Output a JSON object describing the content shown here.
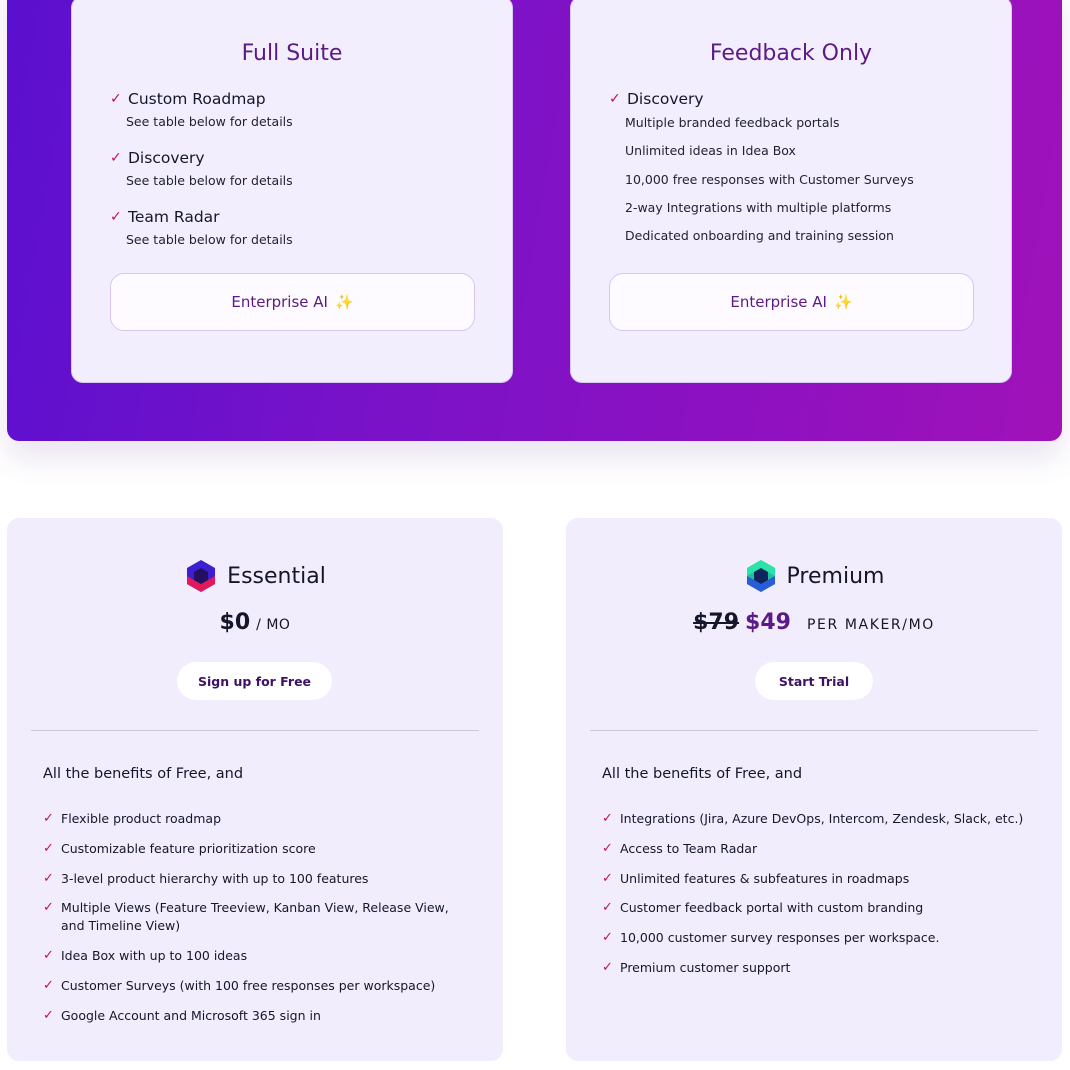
{
  "enterprise": {
    "full_suite": {
      "title": "Full Suite",
      "features": [
        {
          "label": "Custom Roadmap",
          "note": "See table below for details"
        },
        {
          "label": "Discovery",
          "note": "See table below for details"
        },
        {
          "label": "Team Radar",
          "note": "See table below for details"
        }
      ],
      "button_label": "Enterprise AI",
      "button_icon": "sparkles-icon"
    },
    "feedback_only": {
      "title": "Feedback Only",
      "feature": "Discovery",
      "details": [
        "Multiple branded feedback portals",
        "Unlimited ideas in Idea Box",
        "10,000 free responses with Customer Surveys",
        "2-way Integrations with multiple platforms",
        "Dedicated onboarding and training session"
      ],
      "button_label": "Enterprise AI",
      "button_icon": "sparkles-icon"
    }
  },
  "plans": {
    "essential": {
      "name": "Essential",
      "price": "$0",
      "unit": "/ MO",
      "cta": "Sign up for Free",
      "intro": "All the benefits of Free, and",
      "features": [
        "Flexible product roadmap",
        "Customizable feature prioritization score",
        "3-level product hierarchy with up to 100 features",
        "Multiple Views (Feature Treeview, Kanban View, Release View, and Timeline View)",
        "Idea Box with up to 100 ideas",
        "Customer Surveys (with 100 free responses per workspace)",
        "Google Account and Microsoft 365 sign in"
      ]
    },
    "premium": {
      "name": "Premium",
      "old_price": "$79",
      "price": "$49",
      "unit": "PER MAKER/MO",
      "cta": "Start Trial",
      "intro": "All the benefits of Free, and",
      "features": [
        "Integrations (Jira, Azure DevOps, Intercom, Zendesk, Slack, etc.)",
        "Access to Team Radar",
        "Unlimited features & subfeatures in roadmaps",
        "Customer feedback portal with custom branding",
        "10,000 customer survey responses per workspace.",
        "Premium customer support"
      ]
    }
  },
  "colors": {
    "band_gradient_start": "#5a10cf",
    "band_gradient_end": "#a012b8",
    "card_bg": "#f1edfd",
    "accent_purple": "#5c1a86",
    "check_red": "#c1124f"
  }
}
